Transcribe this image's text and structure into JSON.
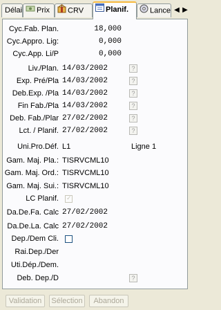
{
  "tabs": [
    {
      "label": "Délai",
      "icon": "none"
    },
    {
      "label": "Prix",
      "icon": "money-icon"
    },
    {
      "label": "CRV",
      "icon": "gift-icon"
    },
    {
      "label": "Planif.",
      "icon": "calendar-icon",
      "active": true
    },
    {
      "label": "Lance",
      "icon": "disc-icon"
    }
  ],
  "tab_scroll": {
    "left": "◀",
    "right": "▶"
  },
  "fields": {
    "cyc_fab_plan": {
      "label": "Cyc.Fab. Plan.",
      "value": "18,000"
    },
    "cyc_appro_lig": {
      "label": "Cyc.Appro. Lig:",
      "value": "0,000"
    },
    "cyc_app_li": {
      "label": "Cyc.App. Li/P",
      "value": "0,000"
    },
    "liv_plan": {
      "label": "Liv./Plan.",
      "value": "14/03/2002"
    },
    "exp_pre_pla": {
      "label": "Exp. Pré/Pla",
      "value": "14/03/2002"
    },
    "deb_exp_pla": {
      "label": "Deb.Exp. /Pla",
      "value": "14/03/2002"
    },
    "fin_fab_pla": {
      "label": "Fin Fab./Pla",
      "value": "14/03/2002"
    },
    "deb_fab_plar": {
      "label": "Deb. Fab./Plar",
      "value": "27/02/2002"
    },
    "lct_planif": {
      "label": "Lct. / Planif.",
      "value": "27/02/2002"
    },
    "uni_pro_def": {
      "label": "Uni.Pro.Déf.",
      "value": "L1",
      "extra": "Ligne 1"
    },
    "gam_maj_pla": {
      "label": "Gam. Maj. Pla.:",
      "value": "TISRVCML10"
    },
    "gam_maj_ord": {
      "label": "Gam. Maj. Ord.:",
      "value": "TISRVCML10"
    },
    "gam_maj_sui": {
      "label": "Gam. Maj. Sui.:",
      "value": "TISRVCML10"
    },
    "lc_planif": {
      "label": "LC Planif.",
      "checked": true
    },
    "da_de_fa_calc": {
      "label": "Da.De.Fa. Calc",
      "value": "27/02/2002"
    },
    "da_de_la_calc": {
      "label": "Da.De.La. Calc",
      "value": "27/02/2002"
    },
    "dep_dem_cli": {
      "label": "Dep./Dem Cli.",
      "checked": false
    },
    "rai_dep_der": {
      "label": "Rai.Dep./Der"
    },
    "uti_dep_dem": {
      "label": "Uti.Dép./Dem."
    },
    "deb_dep_d": {
      "label": "Deb. Dep./D"
    }
  },
  "help_glyph": "?",
  "buttons": {
    "validation": "Validation",
    "selection": "Sélection",
    "abandon": "Abandon"
  }
}
